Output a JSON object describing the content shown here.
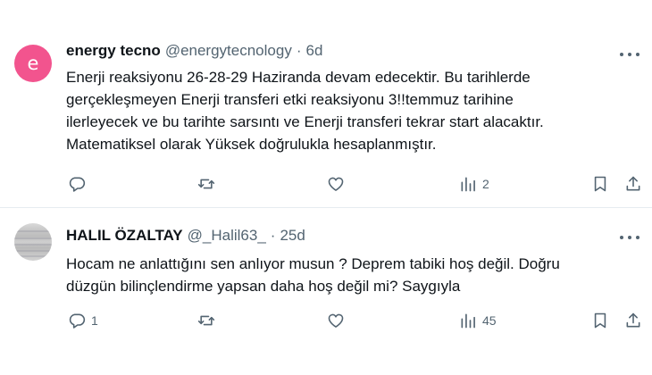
{
  "tweets": [
    {
      "avatar_letter": "e",
      "avatar_color": "#f2548e",
      "name": "energy tecno",
      "handle": "@energytecnology",
      "separator": "·",
      "time": "6d",
      "lines": [
        "Enerji reaksiyonu 26-28-29 Haziranda devam edecektir. Bu tarihlerde",
        "gerçekleşmeyen Enerji transferi etki reaksiyonu 3!!temmuz tarihine",
        "ilerleyecek ve bu tarihte sarsıntı ve Enerji transferi tekrar start alacaktır.",
        "Matematiksel olarak Yüksek doğrulukla hesaplanmıştır."
      ],
      "replies": "",
      "reposts": "",
      "likes": "",
      "views": "2"
    },
    {
      "name": "HALIL ÖZALTAY",
      "handle": "@_Halil63_",
      "separator": "·",
      "time": "25d",
      "lines": [
        "Hocam ne anlattığını sen anlıyor musun ? Deprem tabiki hoş değil. Doğru",
        "düzgün bilinçlendirme yapsan daha  hoş değil mi? Saygıyla"
      ],
      "replies": "1",
      "reposts": "",
      "likes": "",
      "views": "45"
    }
  ],
  "colors": {
    "text": "#0f1419",
    "secondary": "#536471",
    "divider": "#e6ecf0"
  }
}
